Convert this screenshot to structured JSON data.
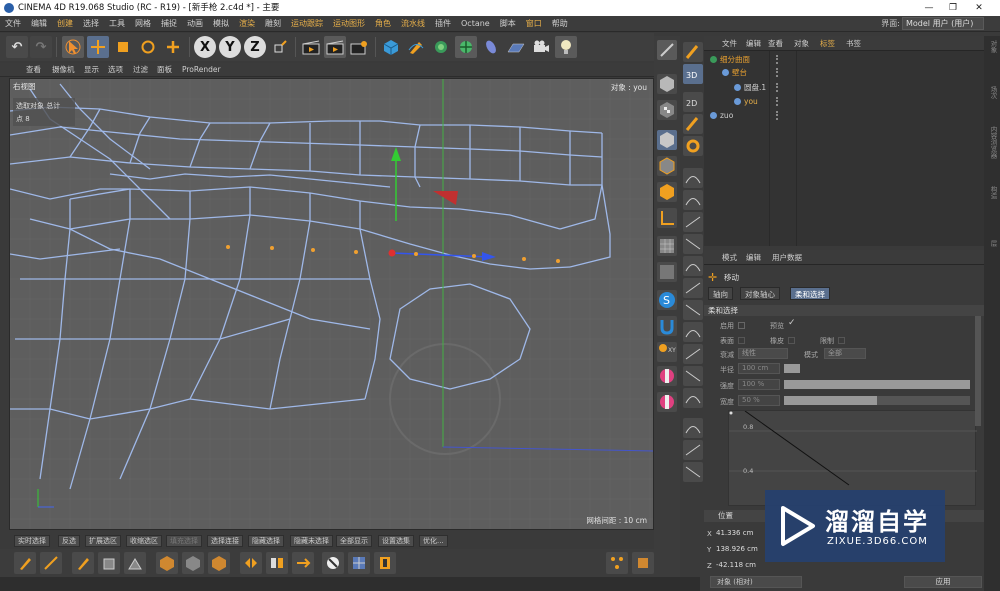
{
  "titlebar": {
    "title": "CINEMA 4D R19.068 Studio (RC - R19) - [新手枪 2.c4d *] - 主要",
    "minimize": "—",
    "maximize": "❐",
    "close": "✕"
  },
  "menubar": {
    "items": [
      "文件",
      "编辑",
      "创建",
      "选择",
      "工具",
      "网格",
      "捕捉",
      "动画",
      "模拟",
      "渲染",
      "雕刻",
      "运动跟踪",
      "运动图形",
      "角色",
      "流水线",
      "插件",
      "Octane",
      "脚本",
      "窗口",
      "帮助"
    ],
    "highlighted": [
      2,
      9,
      11,
      12,
      13,
      14,
      18
    ],
    "layout_label": "界面:",
    "layout_value": "Model 用户 (用户)"
  },
  "toolbar": {
    "undo": "↶",
    "redo": "↷",
    "axis_x": "X",
    "axis_y": "Y",
    "axis_z": "Z"
  },
  "viewport_menu": {
    "items": [
      "查看",
      "摄像机",
      "显示",
      "选项",
      "过滤",
      "面板",
      "ProRender"
    ]
  },
  "viewport": {
    "view_name": "右视图",
    "object_label": "对象 : you",
    "hud_line1": "选取对象 总计",
    "hud_line2": "点  8",
    "grid_spacing": "网格间距 : 10 cm"
  },
  "bottombar": {
    "buttons": [
      "实时选择",
      "反选",
      "扩展选区",
      "收缩选区",
      "填充选择",
      "选择连接",
      "隐藏选择",
      "隐藏未选择",
      "全部显示",
      "设置选集",
      "优化..."
    ]
  },
  "object_manager": {
    "menu": [
      "文件",
      "编辑",
      "查看",
      "对象",
      "标签",
      "书签"
    ],
    "rows": [
      {
        "name": "细分曲面",
        "indent": 0,
        "color": "#e8a030"
      },
      {
        "name": "壁台",
        "indent": 1,
        "color": "#e8a030"
      },
      {
        "name": "圆盘.1",
        "indent": 2,
        "color": "#d0d0d0"
      },
      {
        "name": "you",
        "indent": 2,
        "color": "#e8b04a"
      },
      {
        "name": "zuo",
        "indent": 0,
        "color": "#d0d0d0"
      }
    ]
  },
  "attribute_manager": {
    "menu": [
      "模式",
      "编辑",
      "用户数据"
    ],
    "tool_name": "移动",
    "tabs": [
      "轴向",
      "对象轴心",
      "柔和选择"
    ],
    "active_tab": 2,
    "section": "柔和选择",
    "enable_label": "启用",
    "preview_label": "预览",
    "surface_label": "表面",
    "rubber_label": "橡皮",
    "restrict_label": "限制",
    "mode_label": "衰减",
    "mode_value": "线性",
    "mode2_label": "模式",
    "mode2_value": "全部",
    "radius_label": "半径",
    "radius_value": "100 cm",
    "strength_label": "强度",
    "strength_value": "100 %",
    "strength_fill": 1.0,
    "width_label": "宽度",
    "width_value": "50 %",
    "width_fill": 0.5,
    "graph_ticks": [
      "0.8",
      "0.4"
    ]
  },
  "coordinate_manager": {
    "title": "位置",
    "x_label": "X",
    "x_value": "41.336 cm",
    "y_label": "Y",
    "y_value": "138.926 cm",
    "z_label": "Z",
    "z_value": "-42.118 cm",
    "space_value": "对象 (相对)",
    "apply_label": "应用"
  },
  "right_edge_tabs": [
    "对象",
    "场次",
    "内容浏览器",
    "构造",
    "层"
  ],
  "watermark": {
    "brand": "溜溜自学",
    "url": "ZIXUE.3D66.COM"
  }
}
